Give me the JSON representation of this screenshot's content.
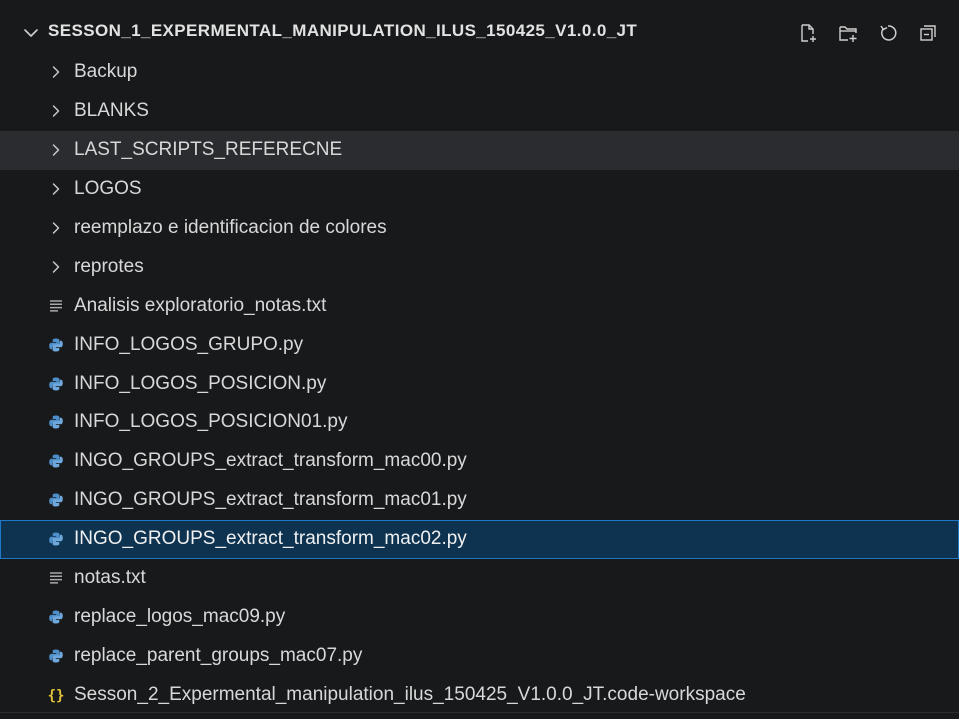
{
  "explorer": {
    "folder_title": "SESSON_1_EXPERMENTAL_MANIPULATION_ILUS_150425_V1.0.0_JT",
    "actions": [
      {
        "name": "new-file-icon"
      },
      {
        "name": "new-folder-icon"
      },
      {
        "name": "refresh-icon"
      },
      {
        "name": "collapse-all-icon"
      }
    ],
    "items": [
      {
        "label": "Backup",
        "kind": "folder",
        "state": "normal"
      },
      {
        "label": "BLANKS",
        "kind": "folder",
        "state": "normal"
      },
      {
        "label": "LAST_SCRIPTS_REFERECNE",
        "kind": "folder",
        "state": "hover"
      },
      {
        "label": "LOGOS",
        "kind": "folder",
        "state": "normal"
      },
      {
        "label": "reemplazo e identificacion de colores",
        "kind": "folder",
        "state": "normal"
      },
      {
        "label": "reprotes",
        "kind": "folder",
        "state": "normal"
      },
      {
        "label": "Analisis exploratorio_notas.txt",
        "kind": "text",
        "state": "normal"
      },
      {
        "label": "INFO_LOGOS_GRUPO.py",
        "kind": "python",
        "state": "normal"
      },
      {
        "label": "INFO_LOGOS_POSICION.py",
        "kind": "python",
        "state": "normal"
      },
      {
        "label": "INFO_LOGOS_POSICION01.py",
        "kind": "python",
        "state": "normal"
      },
      {
        "label": "INGO_GROUPS_extract_transform_mac00.py",
        "kind": "python",
        "state": "normal"
      },
      {
        "label": "INGO_GROUPS_extract_transform_mac01.py",
        "kind": "python",
        "state": "normal"
      },
      {
        "label": "INGO_GROUPS_extract_transform_mac02.py",
        "kind": "python",
        "state": "selected"
      },
      {
        "label": "notas.txt",
        "kind": "text",
        "state": "normal"
      },
      {
        "label": "replace_logos_mac09.py",
        "kind": "python",
        "state": "normal"
      },
      {
        "label": "replace_parent_groups_mac07.py",
        "kind": "python",
        "state": "normal"
      },
      {
        "label": "Sesson_2_Expermental_manipulation_ilus_150425_V1.0.0_JT.code-workspace",
        "kind": "workspace",
        "state": "normal"
      }
    ]
  },
  "colors": {
    "background": "#18191b",
    "selected_bg": "#0e3350",
    "selected_border": "#1d78c8",
    "hover_bg": "#2a2c2f",
    "python_icon": "#4f8fc9",
    "workspace_icon": "#e4c43a"
  }
}
